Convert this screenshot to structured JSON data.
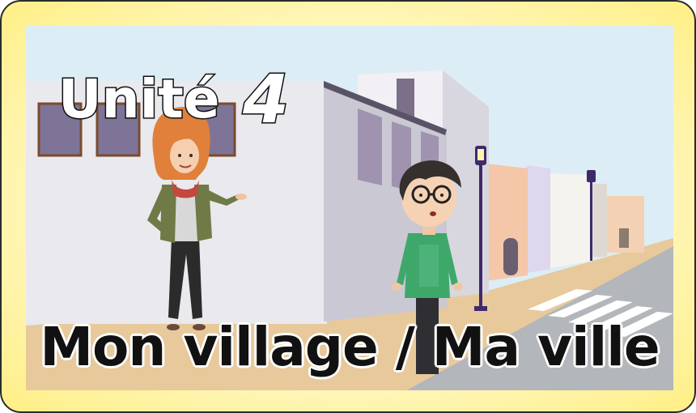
{
  "unit": {
    "word": "Unité",
    "number": "4"
  },
  "title": "Mon village / Ma ville",
  "colors": {
    "frame_border": "#2b2b2b",
    "frame_fill": "#fff7c2",
    "sky": "#dcedf5",
    "sidewalk": "#e8c99b",
    "road": "#b3b6ba",
    "building_main": "#e8e8ec",
    "teacher_hair": "#e0803a",
    "boy_sweater": "#3ea86b"
  },
  "icons": {
    "street_lamp": "street-lamp-icon",
    "crosswalk": "crosswalk-icon"
  }
}
